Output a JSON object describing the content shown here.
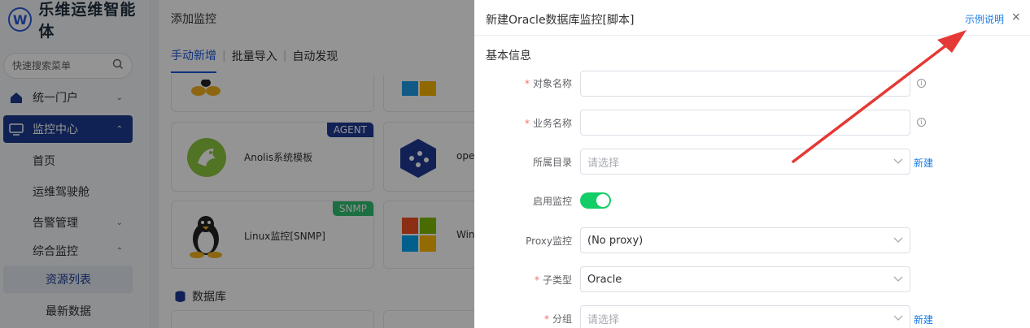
{
  "app": {
    "logo_letter": "W",
    "title": "乐维运维智能体"
  },
  "sidebar": {
    "search_placeholder": "快速搜索菜单",
    "items": [
      {
        "label": "统一门户"
      },
      {
        "label": "监控中心"
      }
    ],
    "subitems": [
      {
        "label": "首页"
      },
      {
        "label": "运维驾驶舱"
      },
      {
        "label": "告警管理"
      },
      {
        "label": "综合监控"
      }
    ],
    "sub2items": [
      {
        "label": "资源列表"
      },
      {
        "label": "最新数据"
      }
    ]
  },
  "main": {
    "title": "添加监控",
    "tabs": [
      {
        "label": "手动新增"
      },
      {
        "label": "批量导入"
      },
      {
        "label": "自动发现"
      }
    ],
    "cards": [
      {
        "label": "Anolis系统模板",
        "badge": "AGENT"
      },
      {
        "label": "ope"
      },
      {
        "label": "Linux监控[SNMP]",
        "badge": "SNMP"
      },
      {
        "label": "Win"
      }
    ],
    "section": "数据库"
  },
  "drawer": {
    "title": "新建Oracle数据库监控[脚本]",
    "example_link": "示例说明",
    "close": "×",
    "section": "基本信息",
    "fields": [
      {
        "label": "对象名称",
        "required": "*",
        "value": ""
      },
      {
        "label": "业务名称",
        "required": "*",
        "value": ""
      },
      {
        "label": "所属目录",
        "placeholder": "请选择",
        "link": "新建"
      },
      {
        "label": "启用监控",
        "toggle": true
      },
      {
        "label": "Proxy监控",
        "value": "(No proxy)"
      },
      {
        "label": "子类型",
        "required": "*",
        "value": "Oracle"
      },
      {
        "label": "分组",
        "required": "*",
        "placeholder": "请选择",
        "link": "新建"
      }
    ]
  },
  "colors": {
    "brand": "#1a3c8f",
    "link": "#1a7be6",
    "toggle_on": "#13ce66",
    "required": "#f56c6c",
    "annotation_arrow": "#e53935"
  }
}
